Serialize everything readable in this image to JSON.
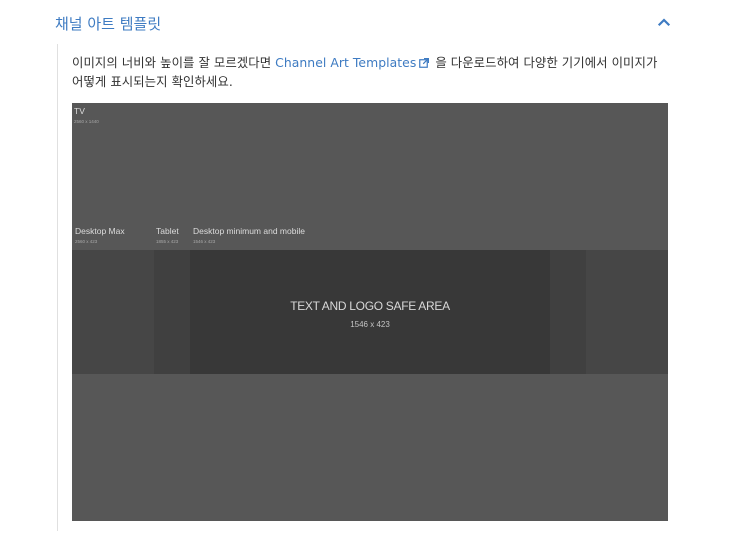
{
  "accordion": {
    "title": "채널 아트 템플릿",
    "expanded": true,
    "accent_color": "#3e7bc2"
  },
  "description": {
    "text_before": "이미지의 너비와 높이를 잘 모르겠다면 ",
    "link_text": "Channel Art Templates",
    "text_after": " 을 다운로드하여 다양한 기기에서 이미지가 어떻게 표시되는지 확인하세요.",
    "link_icon": "external-link-icon"
  },
  "template_image": {
    "tv": {
      "label": "TV",
      "size": "2560 x 1440"
    },
    "desktop_max": {
      "label": "Desktop Max",
      "size": "2560 x 423"
    },
    "tablet": {
      "label": "Tablet",
      "size": "1855 x 423"
    },
    "desktop_min": {
      "label": "Desktop minimum and mobile",
      "size": "1546 x 423"
    },
    "safe_area": {
      "label": "TEXT AND LOGO SAFE AREA",
      "size": "1546 x 423"
    }
  }
}
